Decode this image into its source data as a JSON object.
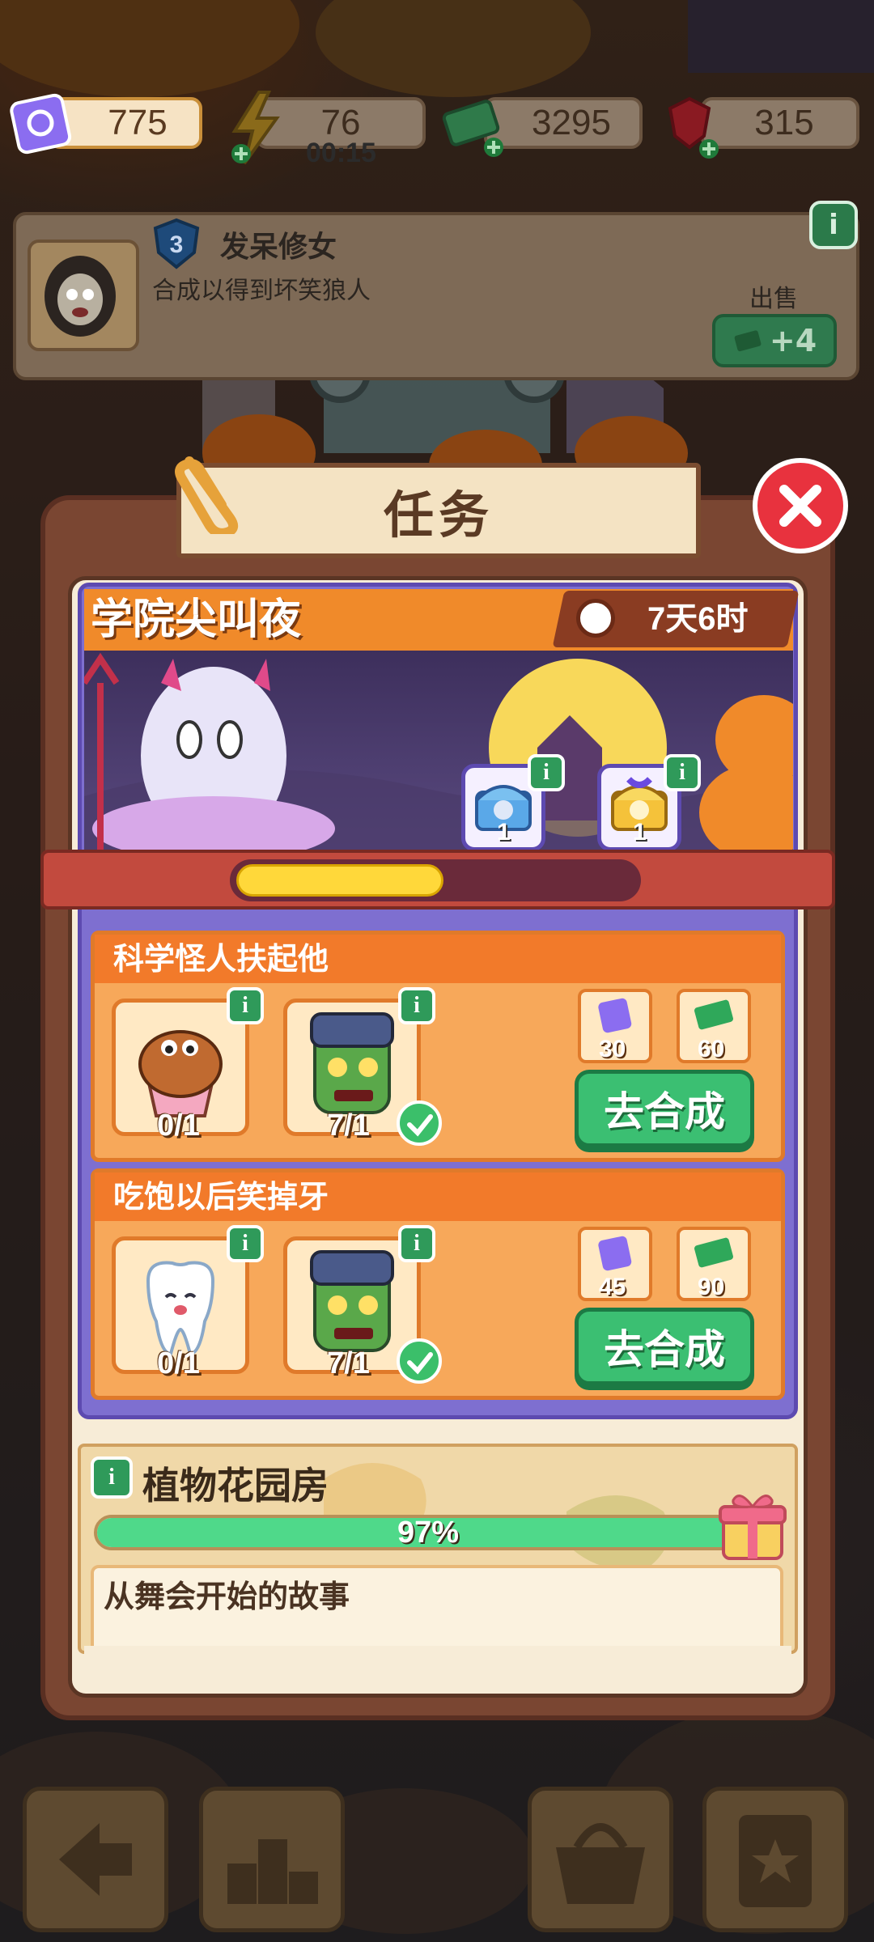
{
  "resources": {
    "tickets": "775",
    "energy": "76",
    "energy_timer": "00:15",
    "cash": "3295",
    "gems": "315"
  },
  "info_card": {
    "level": "3",
    "name": "发呆修女",
    "description": "合成以得到坏笑狼人",
    "sell_label": "出售",
    "sell_value": "+4"
  },
  "modal": {
    "title": "任务"
  },
  "event": {
    "title": "学院尖叫夜",
    "time_left": "7天6时",
    "chests": [
      {
        "name": "blue-chest",
        "count": "1"
      },
      {
        "name": "gold-chest",
        "count": "1"
      }
    ],
    "progress": 0.52
  },
  "tasks": [
    {
      "title": "科学怪人扶起他",
      "items": [
        {
          "icon": "cupcake-icon",
          "count": "0/1",
          "done": false
        },
        {
          "icon": "frankenstein-icon",
          "count": "7/1",
          "done": true
        }
      ],
      "rewards": [
        {
          "icon": "ticket-icon",
          "value": "30"
        },
        {
          "icon": "cash-icon",
          "value": "60"
        }
      ],
      "button": "去合成"
    },
    {
      "title": "吃饱以后笑掉牙",
      "items": [
        {
          "icon": "tooth-icon",
          "count": "0/1",
          "done": false
        },
        {
          "icon": "frankenstein-icon",
          "count": "7/1",
          "done": true
        }
      ],
      "rewards": [
        {
          "icon": "ticket-icon",
          "value": "45"
        },
        {
          "icon": "cash-icon",
          "value": "90"
        }
      ],
      "button": "去合成"
    }
  ],
  "garden": {
    "title": "植物花园房",
    "progress_label": "97%",
    "progress": 0.97,
    "story_title": "从舞会开始的故事"
  },
  "info_glyph": "i",
  "colors": {
    "accent_green": "#3bbf72",
    "accent_orange": "#f27a2a",
    "event_purple": "#7e6fd0",
    "close_red": "#e8323e"
  }
}
